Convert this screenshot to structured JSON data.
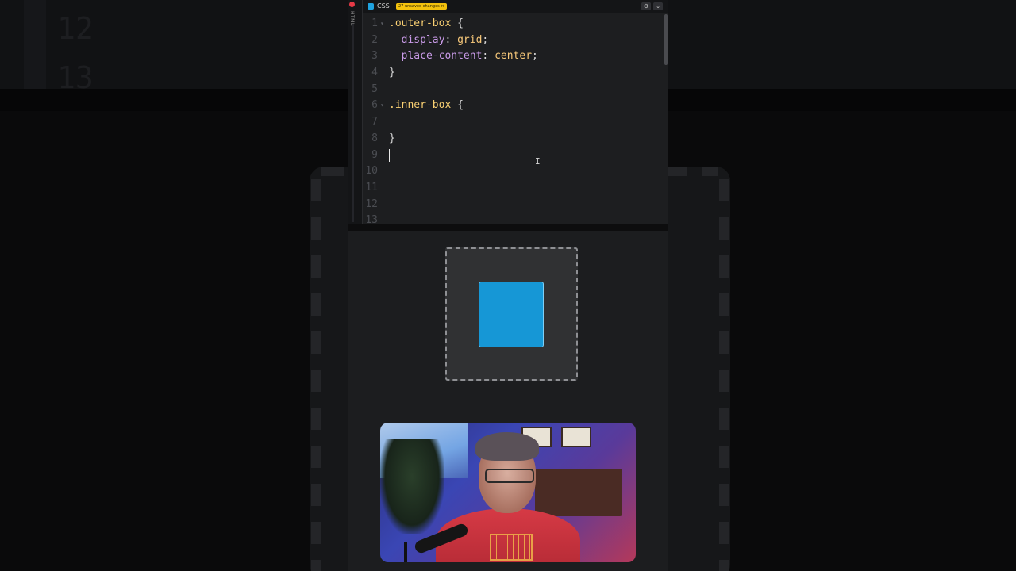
{
  "editor": {
    "language_label": "CSS",
    "unsaved_badge": "27 unsaved changes ×",
    "side_panel_label": "HTML",
    "settings_icon": "gear-icon",
    "collapse_icon": "chevron-down-icon",
    "lines": [
      {
        "n": "1",
        "fold": true,
        "tokens": [
          {
            "t": ".outer-box",
            "c": "sel"
          },
          {
            "t": " {",
            "c": "punc"
          }
        ]
      },
      {
        "n": "2",
        "fold": false,
        "tokens": [
          {
            "t": "  display",
            "c": "prop"
          },
          {
            "t": ": ",
            "c": "punc"
          },
          {
            "t": "grid",
            "c": "val"
          },
          {
            "t": ";",
            "c": "punc"
          }
        ]
      },
      {
        "n": "3",
        "fold": false,
        "tokens": [
          {
            "t": "  place-content",
            "c": "prop"
          },
          {
            "t": ": ",
            "c": "punc"
          },
          {
            "t": "center",
            "c": "val"
          },
          {
            "t": ";",
            "c": "punc"
          }
        ]
      },
      {
        "n": "4",
        "fold": false,
        "tokens": [
          {
            "t": "}",
            "c": "punc"
          }
        ]
      },
      {
        "n": "5",
        "fold": false,
        "tokens": []
      },
      {
        "n": "6",
        "fold": true,
        "tokens": [
          {
            "t": ".inner-box",
            "c": "sel"
          },
          {
            "t": " {",
            "c": "punc"
          }
        ]
      },
      {
        "n": "7",
        "fold": false,
        "tokens": []
      },
      {
        "n": "8",
        "fold": false,
        "tokens": [
          {
            "t": "}",
            "c": "punc"
          }
        ]
      },
      {
        "n": "9",
        "fold": false,
        "tokens": [],
        "caret": true
      },
      {
        "n": "10",
        "fold": false,
        "tokens": []
      },
      {
        "n": "11",
        "fold": false,
        "tokens": []
      },
      {
        "n": "12",
        "fold": false,
        "tokens": []
      },
      {
        "n": "13",
        "fold": false,
        "tokens": []
      }
    ]
  },
  "background_ghost": {
    "numbers": [
      "12",
      "13"
    ]
  },
  "preview": {
    "inner_box_color": "#1697d6",
    "outer_box_color": "#303133"
  },
  "colors": {
    "selector": "#f8cf72",
    "property": "#c99be8",
    "value": "#f7c87a",
    "badge": "#f4c20d"
  }
}
